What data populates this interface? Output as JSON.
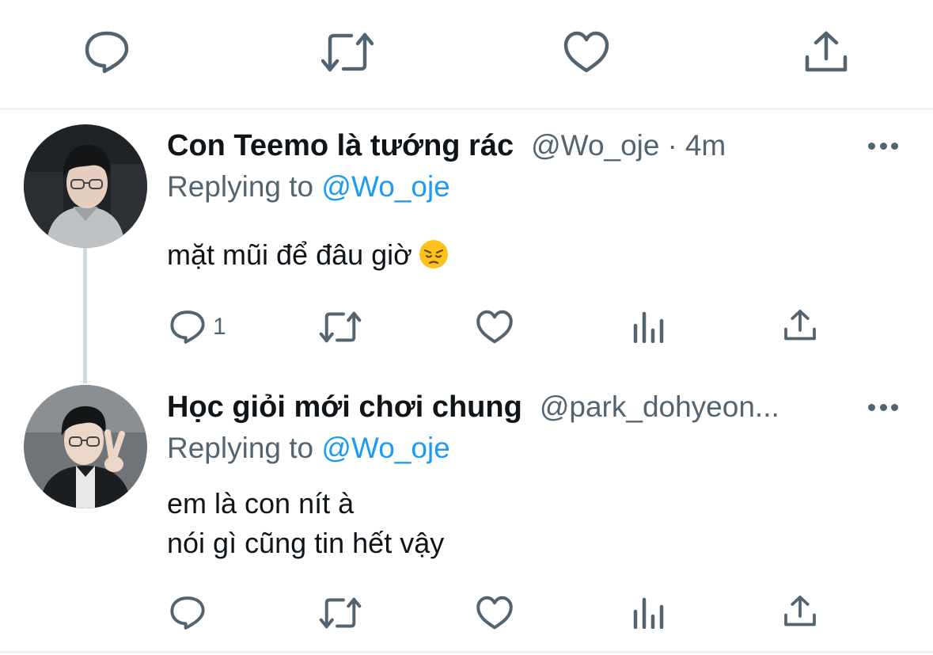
{
  "top_actions": {
    "icons": [
      "reply-icon",
      "retweet-icon",
      "like-icon",
      "share-icon"
    ]
  },
  "tweets": [
    {
      "display_name": "Con Teemo là tướng rác",
      "handle": "@Wo_oje",
      "separator": "·",
      "time": "4m",
      "replying_prefix": "Replying to",
      "replying_to": "@Wo_oje",
      "text": "mặt mũi để đâu giờ",
      "emoji": "pensive-face",
      "reply_count": "1"
    },
    {
      "display_name": "Học giỏi mới chơi chung",
      "handle": "@park_dohyeon...",
      "replying_prefix": "Replying to",
      "replying_to": "@Wo_oje",
      "text_lines": [
        "em là con nít à",
        "nói gì cũng tin hết vậy"
      ]
    }
  ],
  "colors": {
    "text_primary": "#0f1419",
    "text_secondary": "#536471",
    "accent_link": "#1d9bf0",
    "divider": "#eff3f4",
    "thread_line": "#cfd9de"
  }
}
